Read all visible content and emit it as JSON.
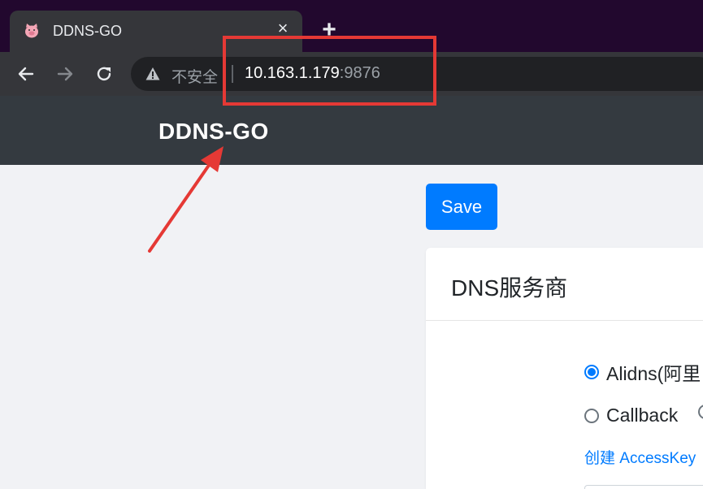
{
  "browser": {
    "tab_title": "DDNS-GO",
    "tab_close": "×",
    "new_tab": "+",
    "security_label": "不安全",
    "url_host": "10.163.1.179",
    "url_port": ":9876"
  },
  "app": {
    "brand": "DDNS-GO",
    "save_label": "Save"
  },
  "dns_card": {
    "title": "DNS服务商",
    "options": [
      {
        "label": "Alidns(阿里",
        "checked": true
      },
      {
        "label": "Callback",
        "checked": false
      },
      {
        "label": "",
        "checked": false
      }
    ],
    "create_link": "创建 AccessKey"
  },
  "colors": {
    "accent": "#007bff",
    "navbar": "#343a40",
    "annotation": "#e53935"
  }
}
